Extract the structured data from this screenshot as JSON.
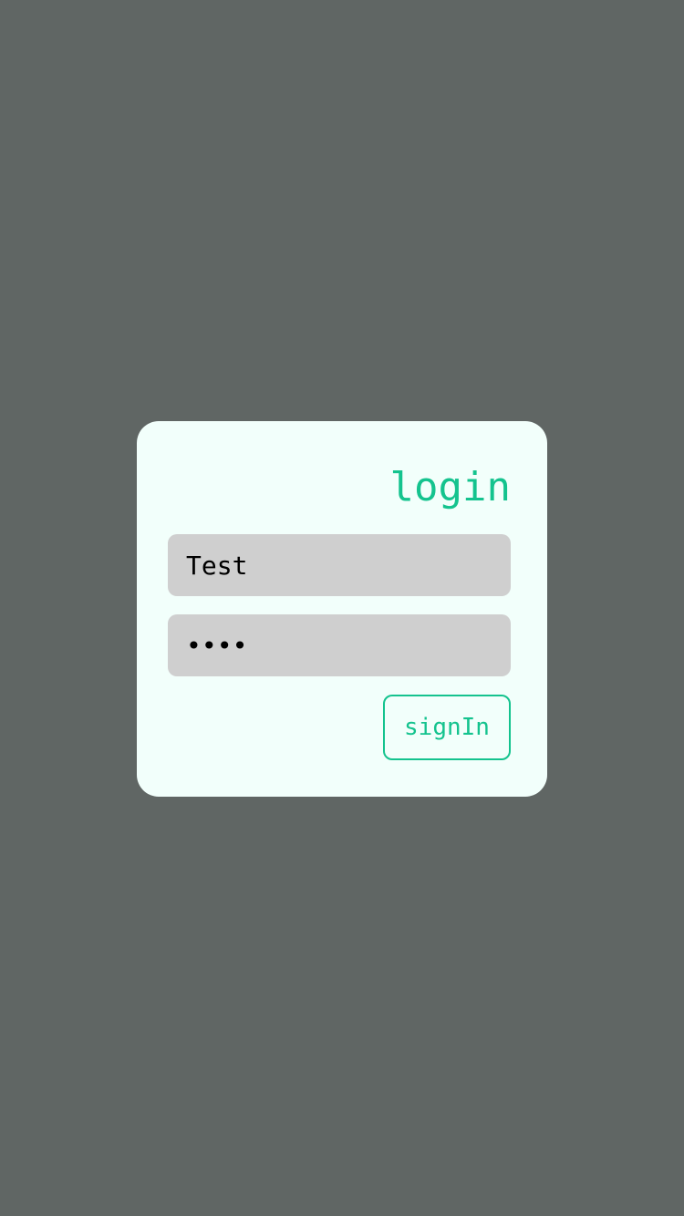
{
  "colors": {
    "background": "#606664",
    "card": "#f2fffb",
    "accent": "#14c38e",
    "field": "#cfcfcf",
    "field_text": "#000000"
  },
  "login_card": {
    "title": "login",
    "username_field": {
      "value": "Test"
    },
    "password_field": {
      "masked_value": "••••"
    },
    "signin_label": "signIn"
  }
}
